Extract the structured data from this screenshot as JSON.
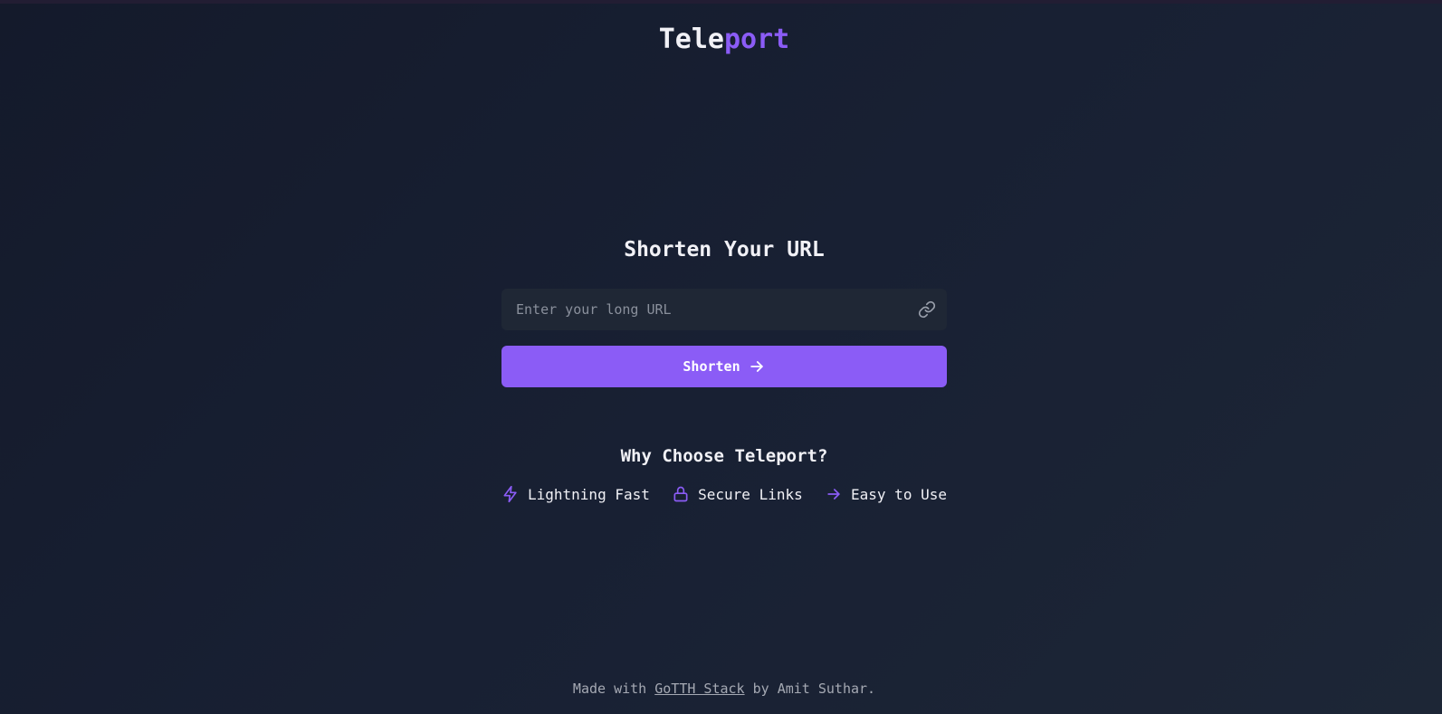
{
  "logo": {
    "part1": "Tele",
    "part2": "port"
  },
  "form": {
    "title": "Shorten Your URL",
    "url_placeholder": "Enter your long URL",
    "url_value": "",
    "submit_label": "Shorten"
  },
  "features": {
    "heading": "Why Choose Teleport?",
    "items": [
      {
        "label": "Lightning Fast",
        "icon": "lightning-icon"
      },
      {
        "label": "Secure Links",
        "icon": "lock-icon"
      },
      {
        "label": "Easy to Use",
        "icon": "arrow-right-icon"
      }
    ]
  },
  "footer": {
    "prefix": "Made with ",
    "link_label": "GoTTH Stack",
    "suffix": " by Amit Suthar."
  },
  "colors": {
    "accent": "#8b5cf6",
    "background": "#161d2e",
    "input_bg": "#1f2735"
  }
}
